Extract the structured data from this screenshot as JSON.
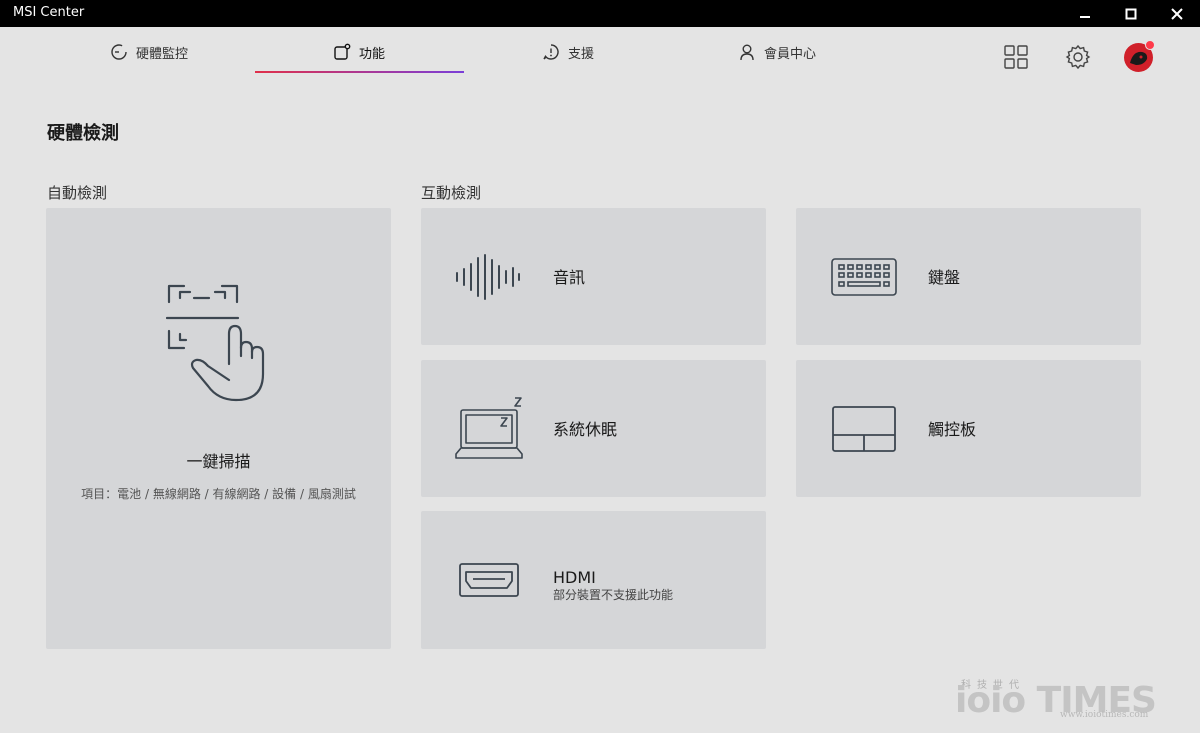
{
  "window": {
    "title": "MSI Center"
  },
  "nav": {
    "tabs": [
      {
        "label": "硬體監控"
      },
      {
        "label": "功能"
      },
      {
        "label": "支援"
      },
      {
        "label": "會員中心"
      }
    ],
    "active": "功能"
  },
  "page": {
    "title": "硬體檢測",
    "auto_section": "自動檢測",
    "interactive_section": "互動檢測"
  },
  "auto_scan": {
    "label": "一鍵掃描",
    "sub": "項目：電池 / 無線網路 / 有線網路 / 設備 / 風扇測試"
  },
  "interactive_items": {
    "audio": {
      "label": "音訊"
    },
    "keyboard": {
      "label": "鍵盤"
    },
    "sleep": {
      "label": "系統休眠"
    },
    "touchpad": {
      "label": "觸控板"
    },
    "hdmi": {
      "label": "HDMI",
      "sub": "部分裝置不支援此功能"
    }
  },
  "watermark": {
    "top": "科技世代",
    "logo": "ioio TIMES",
    "url": "www.ioiotimes.com"
  },
  "colors": {
    "titlebar": "#000000",
    "background": "#e4e4e4",
    "card": "#d5d6d8",
    "accent_start": "#e0304a",
    "accent_end": "#7a3ed8"
  }
}
